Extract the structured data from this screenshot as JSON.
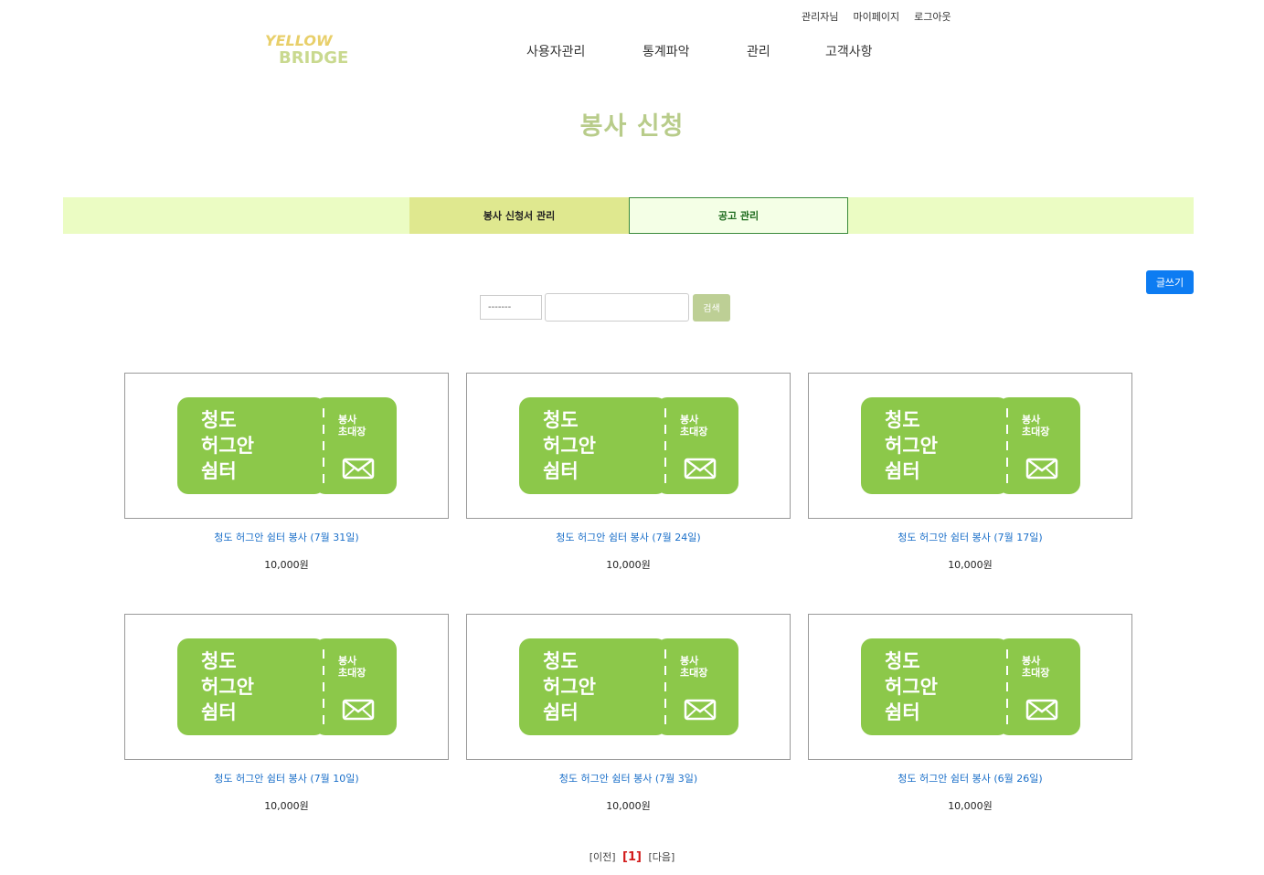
{
  "header": {
    "top_links": [
      "관리자님",
      "마이페이지",
      "로그아웃"
    ],
    "logo_line1": "YELLOW",
    "logo_line2": "BRIDGE",
    "nav": [
      "사용자관리",
      "통계파악",
      "관리",
      "고객사항"
    ]
  },
  "page_title": "봉사 신청",
  "tabs": [
    "봉사 신청서 관리",
    "공고 관리"
  ],
  "write_button": "글쓰기",
  "search": {
    "select_value": "-------",
    "input_value": "",
    "button": "검색"
  },
  "ticket": {
    "line1": "청도",
    "line2": "허그안",
    "line3": "쉼터",
    "stub1": "봉사",
    "stub2": "초대장"
  },
  "cards": [
    {
      "title": "청도 허그안 쉼터 봉사 (7월 31일)",
      "price": "10,000원"
    },
    {
      "title": "청도 허그안 쉼터 봉사 (7월 24일)",
      "price": "10,000원"
    },
    {
      "title": "청도 허그안 쉼터 봉사 (7월 17일)",
      "price": "10,000원"
    },
    {
      "title": "청도 허그안 쉼터 봉사 (7월 10일)",
      "price": "10,000원"
    },
    {
      "title": "청도 허그안 쉼터 봉사 (7월 3일)",
      "price": "10,000원"
    },
    {
      "title": "청도 허그안 쉼터 봉사 (6월 26일)",
      "price": "10,000원"
    }
  ],
  "pager": {
    "prev": "[이전]",
    "current": "[1]",
    "next": "[다음]"
  },
  "colors": {
    "accent": "#b8cc8a",
    "ticket_green": "#8cc84a",
    "tab_bar": "#ebfcc3",
    "tab_active": "#dfe88f",
    "write_button": "#0d7cf2",
    "link": "#1a6fc9"
  }
}
